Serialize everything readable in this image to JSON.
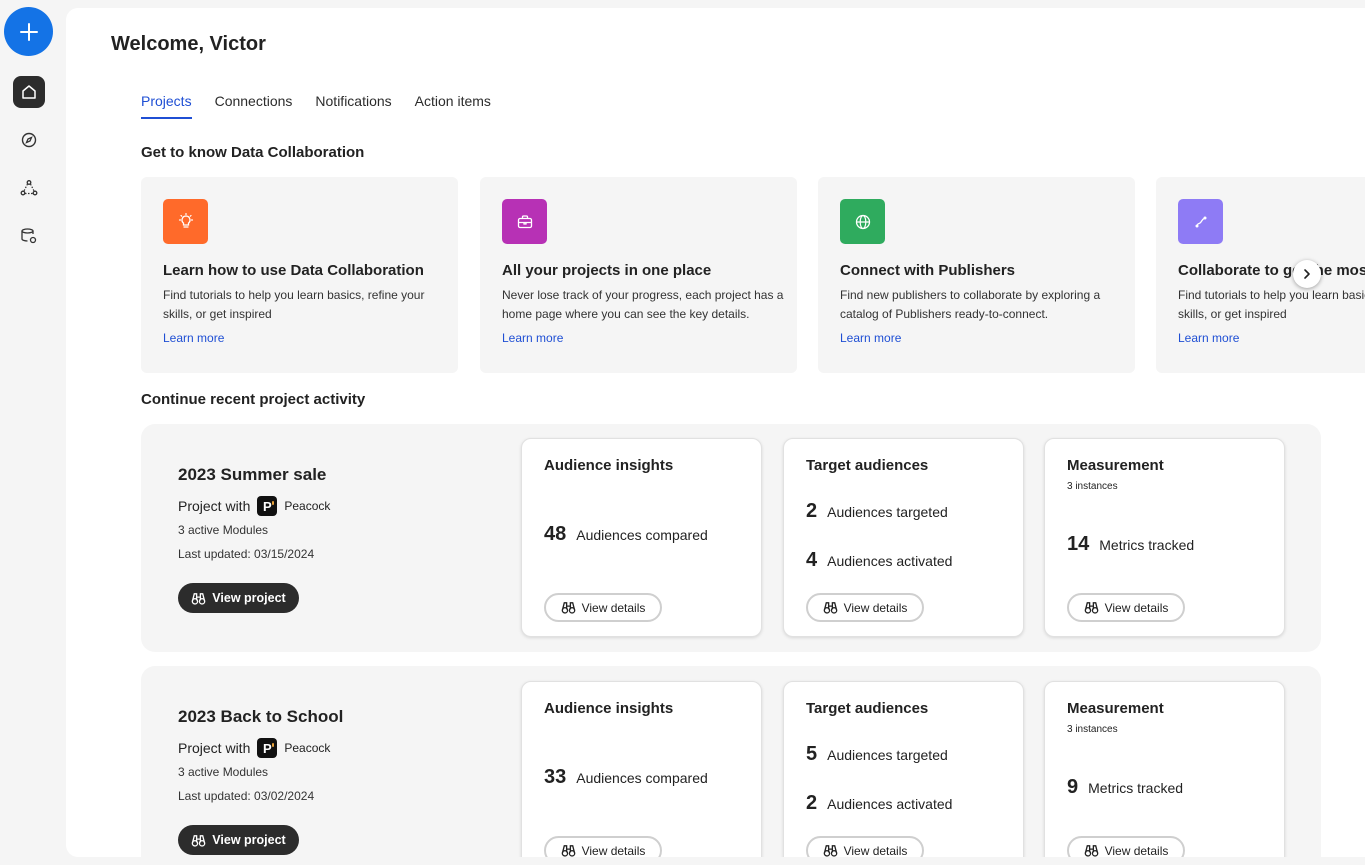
{
  "welcome": "Welcome, Victor",
  "tabs": [
    {
      "label": "Projects",
      "active": true
    },
    {
      "label": "Connections",
      "active": false
    },
    {
      "label": "Notifications",
      "active": false
    },
    {
      "label": "Action items",
      "active": false
    }
  ],
  "intro": {
    "title": "Get to know Data Collaboration",
    "cards": [
      {
        "icon": "lightbulb-icon",
        "color": "#ff6a2a",
        "title": "Learn how to use Data Collaboration",
        "desc": "Find tutorials to help you learn basics, refine your skills, or get inspired",
        "link": "Learn more"
      },
      {
        "icon": "briefcase-icon",
        "color": "#b731b5",
        "title": "All your projects in one place",
        "desc": "Never lose track of your progress, each project has a home page where you can see the key details.",
        "link": "Learn more"
      },
      {
        "icon": "globe-icon",
        "color": "#2fab5e",
        "title": "Connect with Publishers",
        "desc": "Find new publishers to collaborate by exploring a catalog of Publishers ready-to-connect.",
        "link": "Learn more"
      },
      {
        "icon": "path-icon",
        "color": "#8e7bf5",
        "title": "Collaborate to get the most",
        "desc": "Find tutorials to help you learn basics, refine your skills, or get inspired",
        "link": "Learn more"
      }
    ]
  },
  "recent": {
    "title": "Continue recent project activity",
    "projects": [
      {
        "name": "2023 Summer sale",
        "with_label": "Project with",
        "partner": "Peacock",
        "modules": "3 active Modules",
        "updated": "Last updated: 03/15/2024",
        "view_label": "View project",
        "insights": {
          "title": "Audience insights",
          "num": "48",
          "label": "Audiences compared"
        },
        "targets": {
          "title": "Target audiences",
          "targeted_num": "2",
          "targeted_label": "Audiences targeted",
          "activated_num": "4",
          "activated_label": "Audiences activated"
        },
        "measurement": {
          "title": "Measurement",
          "sub": "3 instances",
          "num": "14",
          "label": "Metrics tracked"
        },
        "details_label": "View details"
      },
      {
        "name": "2023 Back to School",
        "with_label": "Project with",
        "partner": "Peacock",
        "modules": "3 active Modules",
        "updated": "Last updated: 03/02/2024",
        "view_label": "View project",
        "insights": {
          "title": "Audience insights",
          "num": "33",
          "label": "Audiences compared"
        },
        "targets": {
          "title": "Target audiences",
          "targeted_num": "5",
          "targeted_label": "Audiences targeted",
          "activated_num": "2",
          "activated_label": "Audiences activated"
        },
        "measurement": {
          "title": "Measurement",
          "sub": "3 instances",
          "num": "9",
          "label": "Metrics tracked"
        },
        "details_label": "View details"
      }
    ]
  },
  "logo_letter": "P",
  "colors": {
    "accent": "#1473e6",
    "link": "#1f4fd4",
    "dark": "#2c2c2c"
  }
}
